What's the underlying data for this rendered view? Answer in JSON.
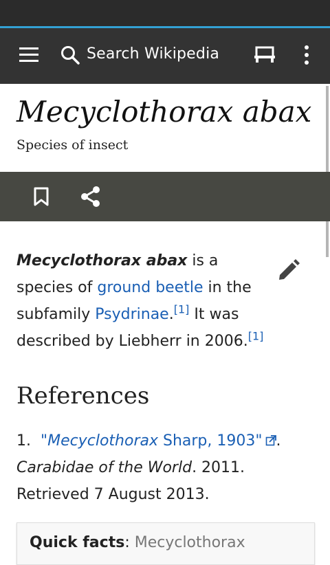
{
  "appbar": {
    "search_placeholder": "Search Wikipedia"
  },
  "article": {
    "title": "Mecyclothorax abax",
    "description": "Species of insect",
    "intro": {
      "bold": "Mecyclothorax abax",
      "t1": " is a species of ",
      "link1": "ground beetle",
      "t2": " in the subfamily ",
      "link2": "Psydrinae",
      "t3": ".",
      "cite1": "[1]",
      "t4": " It was described by Liebherr in 2006.",
      "cite2": "[1]"
    },
    "references_heading": "References",
    "references": [
      {
        "number": "1.",
        "quote_open": "\"",
        "link_italic": "Mecyclothorax",
        "link_rest": " Sharp, 1903",
        "quote_close": "\"",
        "after_link": ".",
        "source": "Carabidae of the World",
        "rest": ". 2011. Retrieved 7 August 2013."
      }
    ],
    "quick_facts": {
      "label": "Quick facts",
      "sep": ": ",
      "value": "Mecyclothorax"
    }
  },
  "colors": {
    "appbar": "#333333",
    "accent_line": "#33a1d4",
    "action_bar": "#474842",
    "link": "#1a5fb4"
  }
}
